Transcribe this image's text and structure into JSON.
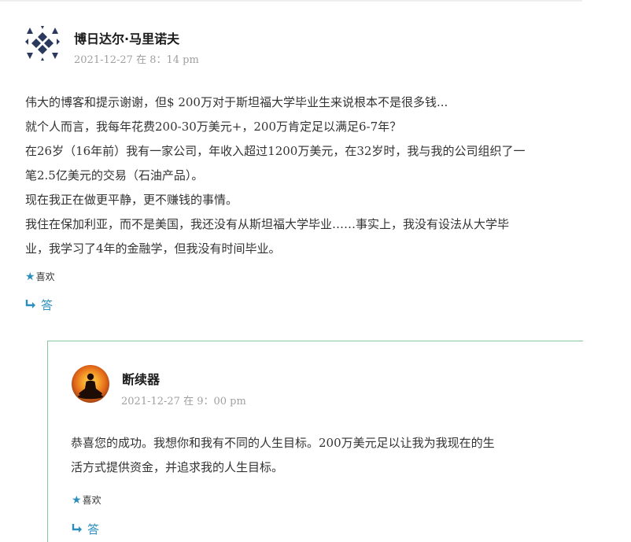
{
  "comments": [
    {
      "author": "博日达尔·马里诺夫",
      "date": "2021-12-27 在 8：14 pm",
      "paragraphs": [
        "伟大的博客和提示谢谢，但$ 200万对于斯坦福大学毕业生来说根本不是很多钱...",
        "就个人而言，我每年花费200-30万美元+，200万肯定足以满足6-7年？",
        "在26岁（16年前）我有一家公司，年收入超过1200万美元，在32岁时，我与我的公司组织了一",
        "笔2.5亿美元的交易（石油产品）。",
        "现在我正在做更平静，更不赚钱的事情。",
        "我住在保加利亚，而不是美国，我还没有从斯坦福大学毕业……事实上，我没有设法从大学毕",
        "业，我学习了4年的金融学，但我没有时间毕业。"
      ],
      "like_label": "喜欢",
      "reply_label": "答"
    },
    {
      "author": "断续器",
      "date": "2021-12-27 在 9：00 pm",
      "paragraphs": [
        "恭喜您的成功。我想你和我有不同的人生目标。200万美元足以让我为我现在的生",
        "活方式提供资金，并追求我的人生目标。"
      ],
      "like_label": "喜欢",
      "reply_label": "答"
    }
  ],
  "colors": {
    "accent": "#2a8fbd",
    "meta": "#a0a0a0",
    "thread_border": "#86c9a0",
    "avatar1": "#2b3a5c"
  },
  "icons": {
    "like": "star-icon",
    "reply": "reply-arrow-icon"
  }
}
